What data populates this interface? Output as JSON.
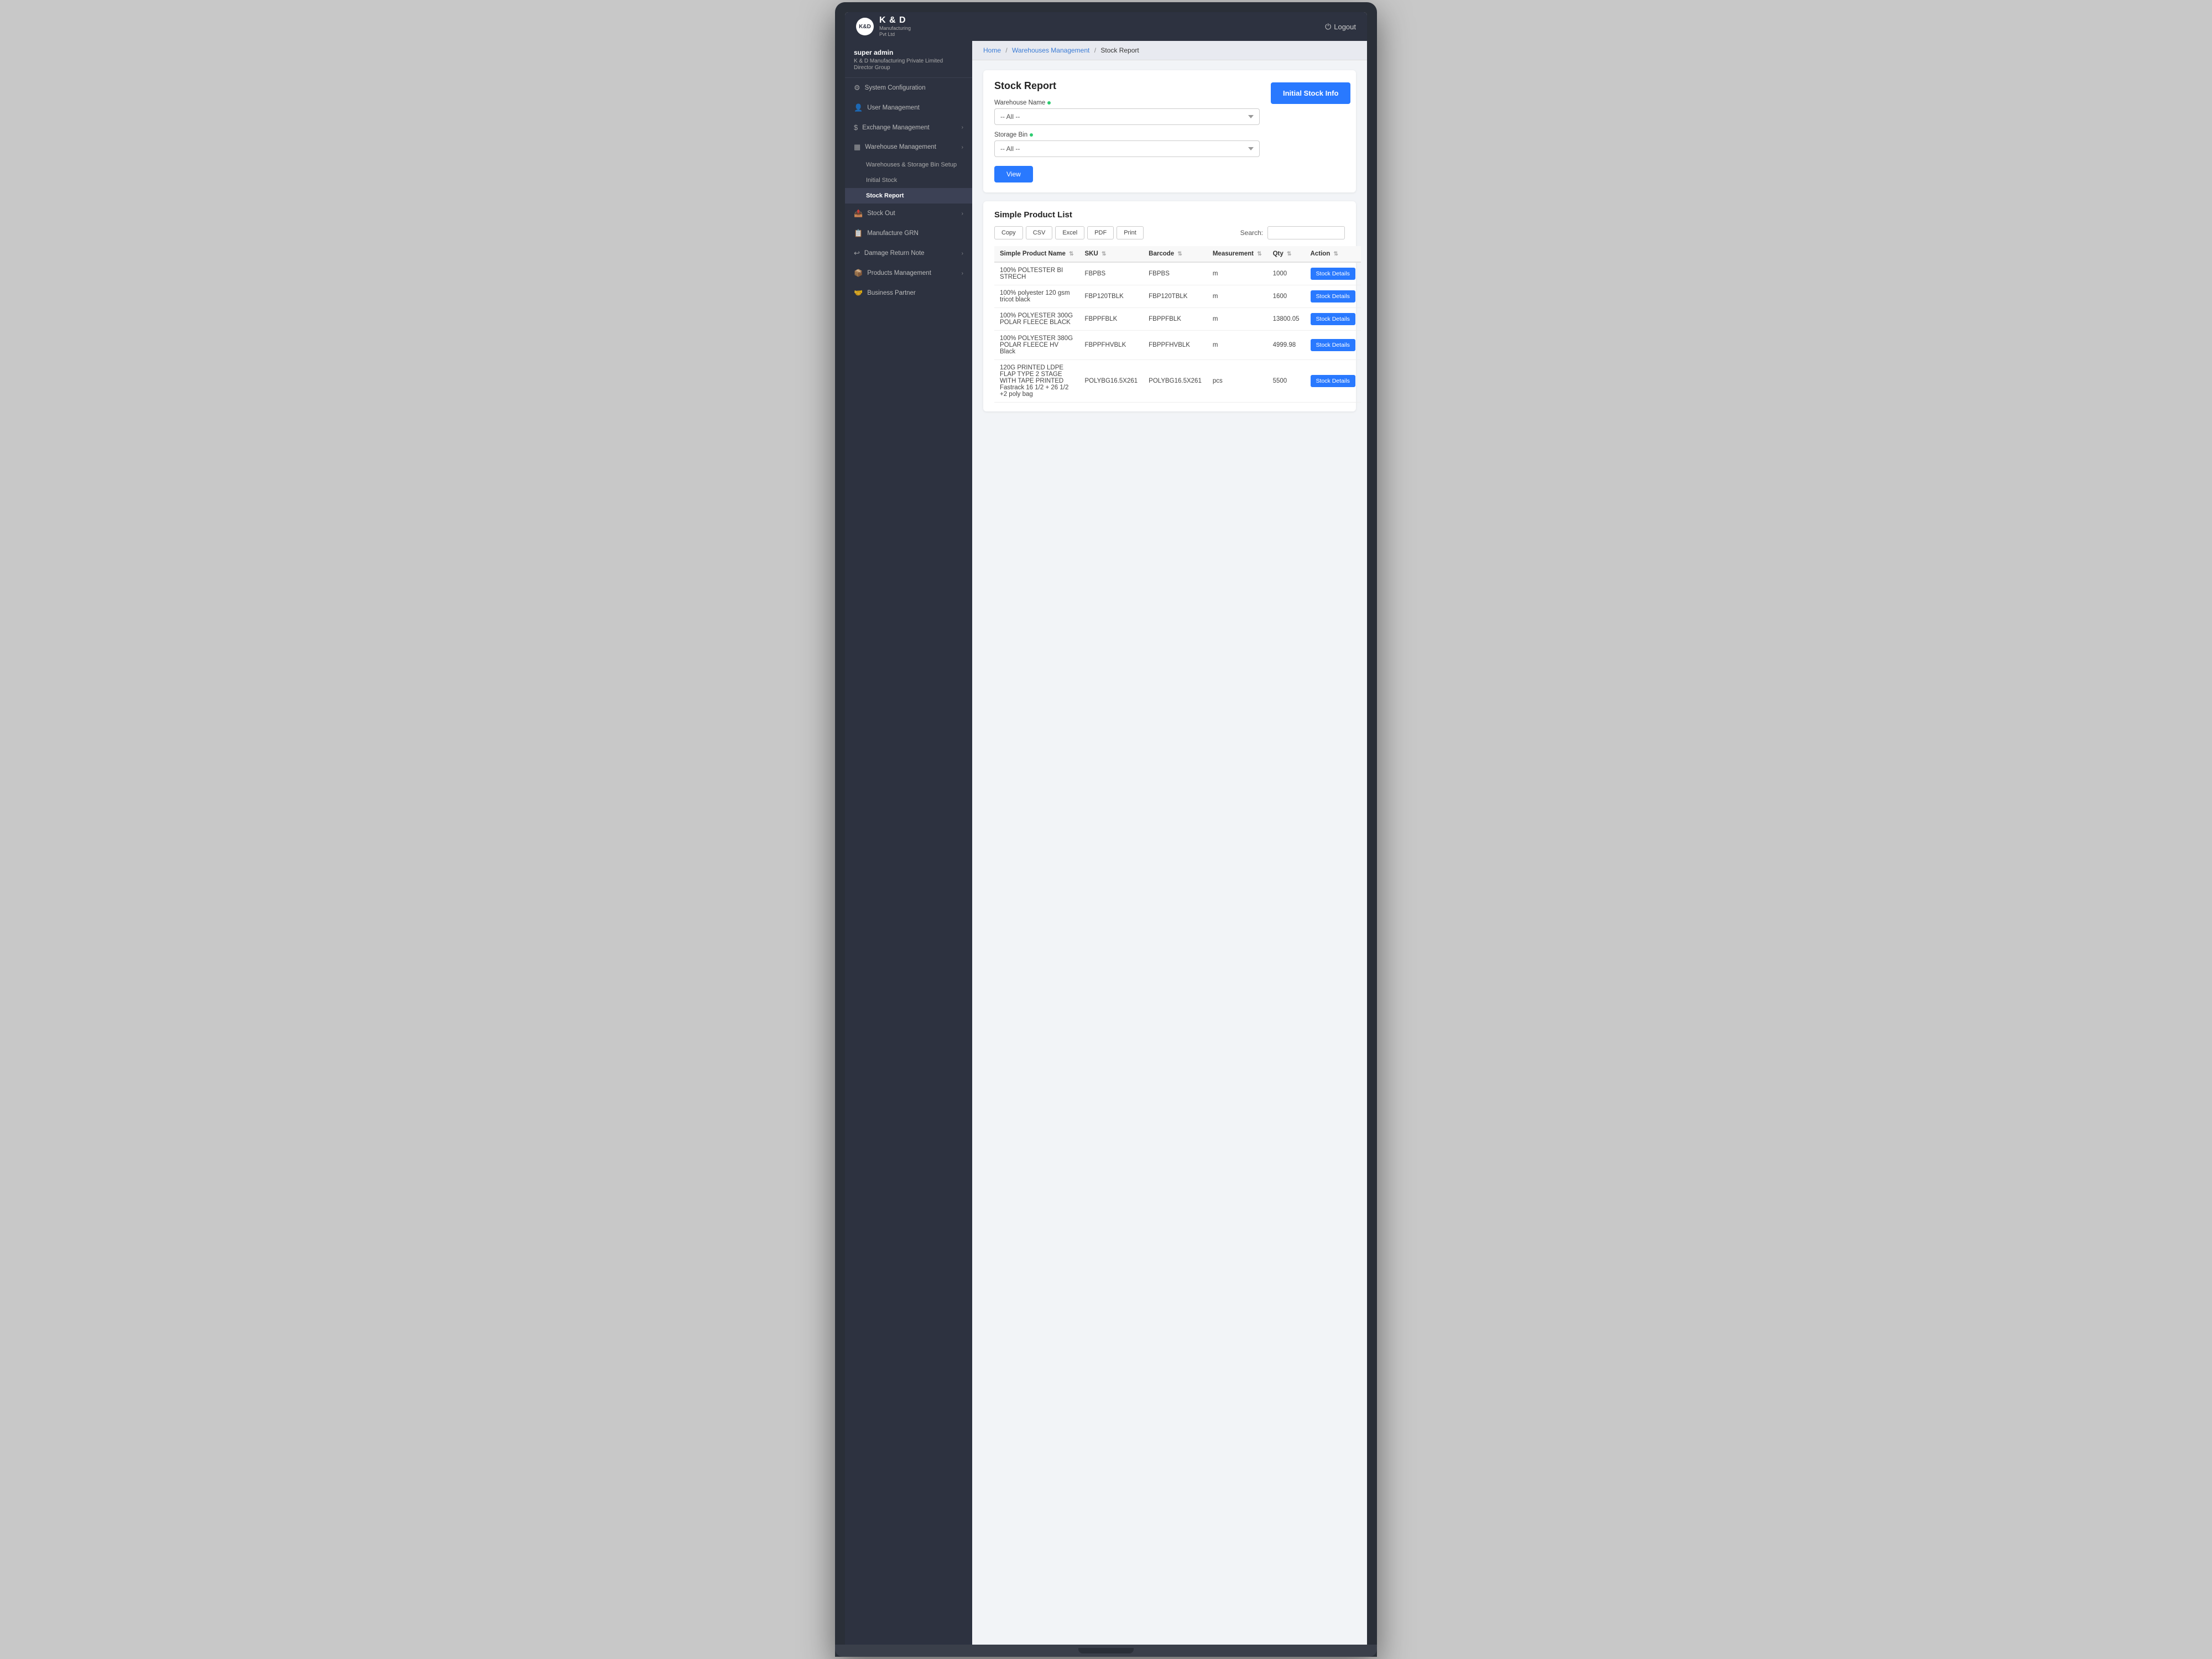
{
  "brand": {
    "logo_text": "K&D",
    "name": "K & D",
    "separator": "&",
    "sub1": "Manufacturing",
    "sub2": "Pvt Ltd"
  },
  "nav": {
    "logout_label": "Logout",
    "logout_icon": "⏻"
  },
  "user": {
    "name": "super admin",
    "company": "K & D Manufacturing Private Limited",
    "role": "Director Group"
  },
  "sidebar": {
    "items": [
      {
        "id": "system-config",
        "icon": "⚙",
        "label": "System Configuration",
        "has_arrow": false
      },
      {
        "id": "user-management",
        "icon": "👤",
        "label": "User Management",
        "has_arrow": false
      },
      {
        "id": "exchange-management",
        "icon": "$",
        "label": "Exchange Management",
        "has_arrow": true
      },
      {
        "id": "warehouse-management",
        "icon": "▦",
        "label": "Warehouse Management",
        "has_arrow": true
      }
    ],
    "warehouse_sub": [
      {
        "id": "warehouses-storage",
        "label": "Warehouses & Storage Bin Setup",
        "active": false
      },
      {
        "id": "initial-stock",
        "label": "Initial Stock",
        "active": false
      },
      {
        "id": "stock-report",
        "label": "Stock Report",
        "active": true
      }
    ],
    "stock_out": {
      "id": "stock-out",
      "icon": "📤",
      "label": "Stock Out",
      "has_arrow": true
    },
    "manufacture_grn": {
      "id": "manufacture-grn",
      "icon": "",
      "label": "Manufacture GRN",
      "has_arrow": false
    },
    "damage_return": {
      "id": "damage-return",
      "icon": "",
      "label": "Damage Return Note",
      "has_arrow": true
    },
    "products_management": {
      "id": "products-management",
      "icon": "📦",
      "label": "Products Management",
      "has_arrow": true
    },
    "business_partner": {
      "id": "business-partner",
      "icon": "🤝",
      "label": "Business Partner",
      "has_arrow": false
    }
  },
  "breadcrumb": {
    "home": "Home",
    "warehouses": "Warehouses Management",
    "current": "Stock Report"
  },
  "page": {
    "title": "Stock Report"
  },
  "initial_stock_btn": "Initial Stock Info",
  "filter": {
    "warehouse_label": "Warehouse Name",
    "warehouse_placeholder": "-- All --",
    "storage_label": "Storage Bin",
    "storage_placeholder": "-- All --",
    "view_btn": "View"
  },
  "product_list": {
    "title": "Simple Product List",
    "search_label": "Search:"
  },
  "toolbar": {
    "copy": "Copy",
    "csv": "CSV",
    "excel": "Excel",
    "pdf": "PDF",
    "print": "Print"
  },
  "table": {
    "headers": [
      {
        "id": "name",
        "label": "Simple Product Name"
      },
      {
        "id": "sku",
        "label": "SKU"
      },
      {
        "id": "barcode",
        "label": "Barcode"
      },
      {
        "id": "measurement",
        "label": "Measurement"
      },
      {
        "id": "qty",
        "label": "Qty"
      },
      {
        "id": "action",
        "label": "Action"
      }
    ],
    "rows": [
      {
        "name": "100% POLTESTER BI STRECH",
        "sku": "FBPBS",
        "barcode": "FBPBS",
        "measurement": "m",
        "qty": "1000",
        "action": "Stock Details"
      },
      {
        "name": "100% polyester 120 gsm tricot black",
        "sku": "FBP120TBLK",
        "barcode": "FBP120TBLK",
        "measurement": "m",
        "qty": "1600",
        "action": "Stock Details"
      },
      {
        "name": "100% POLYESTER 300G POLAR FLEECE BLACK",
        "sku": "FBPPFBLK",
        "barcode": "FBPPFBLK",
        "measurement": "m",
        "qty": "13800.05",
        "action": "Stock Details"
      },
      {
        "name": "100% POLYESTER 380G POLAR FLEECE HV Black",
        "sku": "FBPPFHVBLK",
        "barcode": "FBPPFHVBLK",
        "measurement": "m",
        "qty": "4999.98",
        "action": "Stock Details"
      },
      {
        "name": "120G PRINTED LDPE FLAP TYPE 2 STAGE WITH TAPE PRINTED Fastrack 16 1/2 + 26 1/2 +2 poly bag",
        "sku": "POLYBG16.5X261",
        "barcode": "POLYBG16.5X261",
        "measurement": "pcs",
        "qty": "5500",
        "action": "Stock Details"
      }
    ]
  }
}
